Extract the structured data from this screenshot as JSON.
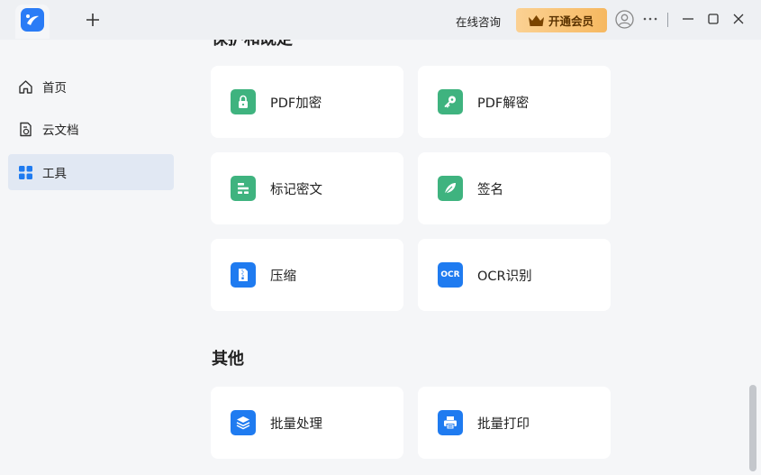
{
  "titlebar": {
    "consult_label": "在线咨询",
    "vip_label": "开通会员",
    "accent_color": "#2a7cf6",
    "vip_color": "#f6b860"
  },
  "sidebar": {
    "items": [
      {
        "label": "首页",
        "icon": "home-icon"
      },
      {
        "label": "云文档",
        "icon": "cloud-doc-icon"
      },
      {
        "label": "工具",
        "icon": "tools-grid-icon",
        "active": true
      }
    ]
  },
  "main": {
    "section_protect_title": "保护和既定",
    "protect_tools": [
      {
        "label": "PDF加密",
        "icon": "lock-icon"
      },
      {
        "label": "PDF解密",
        "icon": "key-icon"
      },
      {
        "label": "标记密文",
        "icon": "redact-icon"
      },
      {
        "label": "签名",
        "icon": "signature-icon"
      },
      {
        "label": "压缩",
        "icon": "compress-icon"
      },
      {
        "label": "OCR识别",
        "icon": "ocr-icon",
        "icon_text": "OCR"
      }
    ],
    "section_other_title": "其他",
    "other_tools": [
      {
        "label": "批量处理",
        "icon": "batch-layers-icon"
      },
      {
        "label": "批量打印",
        "icon": "printer-icon"
      }
    ]
  }
}
